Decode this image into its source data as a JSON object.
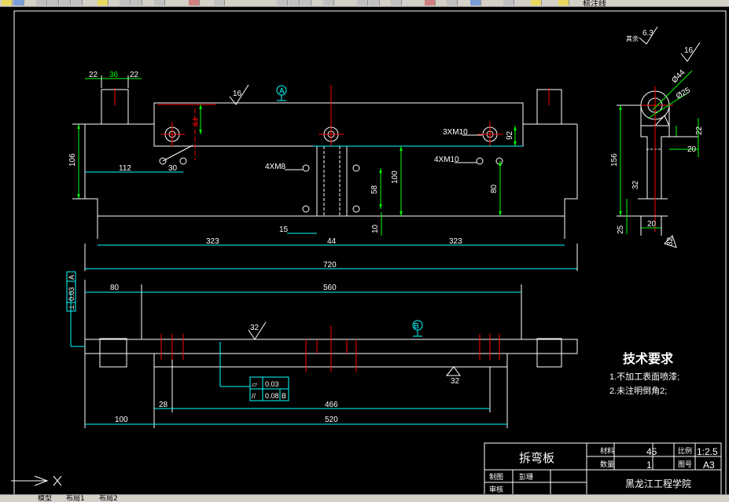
{
  "toolbar": {
    "layer_name": "标注线"
  },
  "tabs": [
    "模型",
    "布局1",
    "布局2"
  ],
  "drawing": {
    "top_view": {
      "dims": {
        "w22a": "22",
        "w36": "36",
        "w22b": "22",
        "h106": "106",
        "d112": "112",
        "d30": "30",
        "d44v": "44",
        "d92": "92",
        "d58": "58",
        "d100": "100",
        "d80": "80",
        "d10": "10",
        "d15": "15",
        "d44": "44",
        "d323a": "323",
        "d323b": "323",
        "d720": "720"
      },
      "notes": {
        "hole_3xm10": "3XM10",
        "hole_4xm8": "4XM8",
        "hole_4xm10": "4XM10",
        "rough16": "16",
        "datum_a": "A"
      }
    },
    "front_view": {
      "dims": {
        "d80": "80",
        "d560": "560",
        "d28": "28",
        "d466": "466",
        "d100": "100",
        "d520": "520"
      },
      "notes": {
        "rough32a": "32",
        "rough32b": "32",
        "datum_b": "B"
      },
      "tol_perp": {
        "sym": "⊥",
        "val": "0.03",
        "ref": "A"
      },
      "tol_flat": {
        "sym": "▱",
        "val": "0.03"
      },
      "tol_par": {
        "sym": "//",
        "val": "0.08",
        "ref": "B"
      }
    },
    "side_view": {
      "dims": {
        "d156": "156",
        "d25": "25",
        "d20a": "20",
        "d20b": "20",
        "d22": "22",
        "d32": "32",
        "dia44": "Ø44",
        "dia25": "Ø25"
      },
      "notes": {
        "rest": "其余",
        "rough63": "6.3",
        "rough16": "16",
        "rough32": "32"
      }
    },
    "tech_req": {
      "title": "技术要求",
      "item1": "1.不加工表面喷漆;",
      "item2": "2.未注明倒角2;"
    },
    "title_block": {
      "part_name": "拆弯板",
      "material_label": "材料",
      "material_value": "45",
      "qty_label": "数量",
      "qty_value": "1",
      "scale_label": "比例",
      "scale_value": "1:2.5",
      "sheet_label": "图号",
      "sheet_value": "A3",
      "drawn_label": "制图",
      "drawn_name": "彭珊",
      "checked_label": "审核",
      "school": "黑龙江工程学院"
    }
  }
}
